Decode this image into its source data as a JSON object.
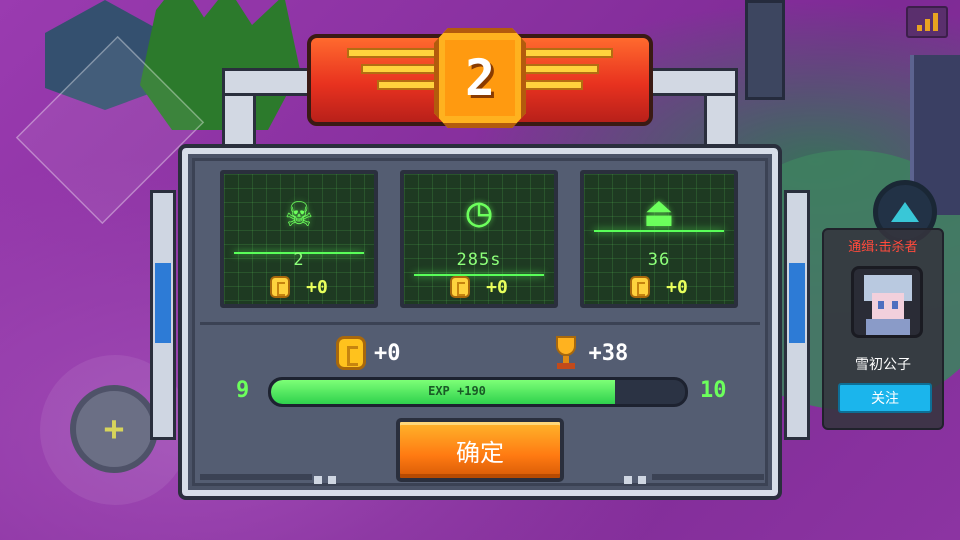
{
  "rank": "2",
  "stats": [
    {
      "icon": "skull-icon",
      "glyph": "☠",
      "value": "2",
      "reward": "+0"
    },
    {
      "icon": "clock-icon",
      "glyph": "◷",
      "value": "285s",
      "reward": "+0"
    },
    {
      "icon": "weight-icon",
      "glyph": "⏏",
      "value": "36",
      "reward": "+0"
    }
  ],
  "totals": {
    "coins": "+0",
    "trophies": "+38"
  },
  "exp": {
    "level_current": "9",
    "level_next": "10",
    "label": "EXP +190",
    "progress": 0.83
  },
  "confirm_label": "确定",
  "wanted": {
    "title": "通缉:击杀者",
    "name": "雪初公子",
    "follow_label": "关注"
  },
  "joystick_glyph": "+",
  "colors": {
    "accent_green": "#6cff5c",
    "confirm_orange": "#ff8a14",
    "follow_blue": "#1bb5ec",
    "wanted_red": "#ff4a3c",
    "background_purple": "#8b2f9c"
  }
}
